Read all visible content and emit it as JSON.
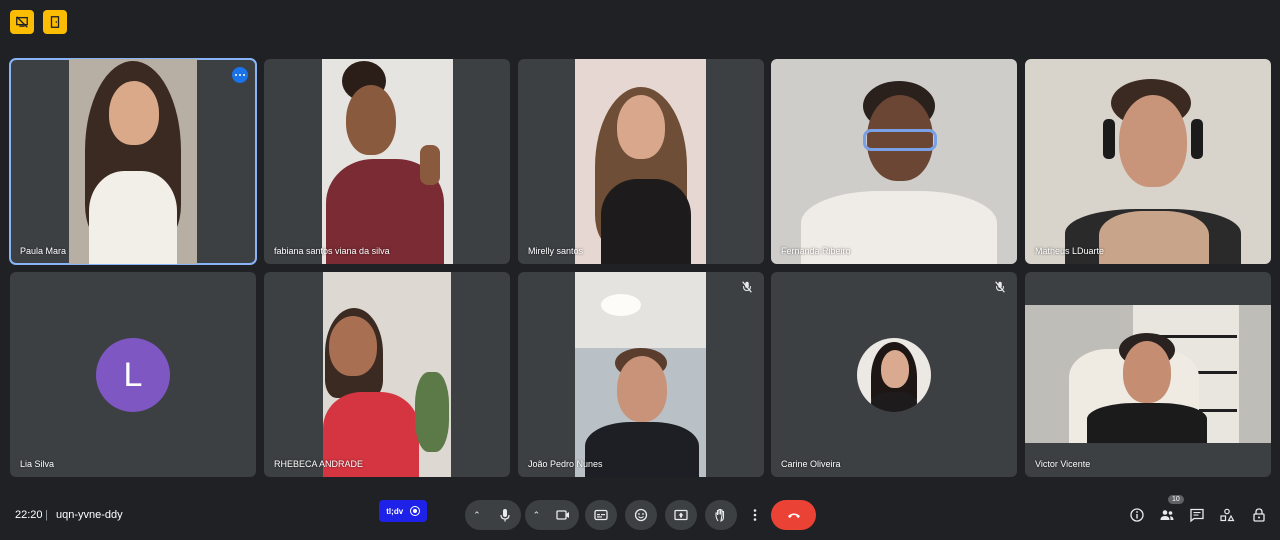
{
  "meeting": {
    "time": "22:20",
    "separator": "|",
    "code": "uqn-yvne-ddy",
    "extension_label": "tl;dv",
    "participants_count": "10"
  },
  "top_icons": [
    "no-screen-share-icon",
    "leave-door-icon"
  ],
  "participants": [
    {
      "name": "Paula Mara",
      "active": true,
      "muted": false
    },
    {
      "name": "fabiana santos viana da silva",
      "active": false,
      "muted": false
    },
    {
      "name": "Mirelly santos",
      "active": false,
      "muted": false
    },
    {
      "name": "Fernanda Ribeiro",
      "active": false,
      "muted": false
    },
    {
      "name": "Matheus LDuarte",
      "active": false,
      "muted": false
    },
    {
      "name": "Lia Silva",
      "active": false,
      "muted": false,
      "avatar_letter": "L"
    },
    {
      "name": "RHEBECA ANDRADE",
      "active": false,
      "muted": false
    },
    {
      "name": "João Pedro Nunes",
      "active": false,
      "muted": true
    },
    {
      "name": "Carine Oliveira",
      "active": false,
      "muted": true
    },
    {
      "name": "Victor Vicente",
      "active": false,
      "muted": false
    }
  ],
  "controls": [
    "mic-caret",
    "mic-icon",
    "camera-caret",
    "camera-icon",
    "captions-icon",
    "emoji-icon",
    "present-screen-icon",
    "raise-hand-icon",
    "more-options-icon",
    "end-call-icon"
  ],
  "right_controls": [
    "info-icon",
    "people-icon",
    "chat-icon",
    "activities-icon",
    "host-controls-icon"
  ],
  "colors": {
    "background": "#202124",
    "tile": "#3c4043",
    "active_outline": "#8ab4f8",
    "end_call": "#ea4335",
    "top_icon": "#fbbc04",
    "avatar_purple": "#7e57c2",
    "tldv_blue": "#1e22e8"
  }
}
